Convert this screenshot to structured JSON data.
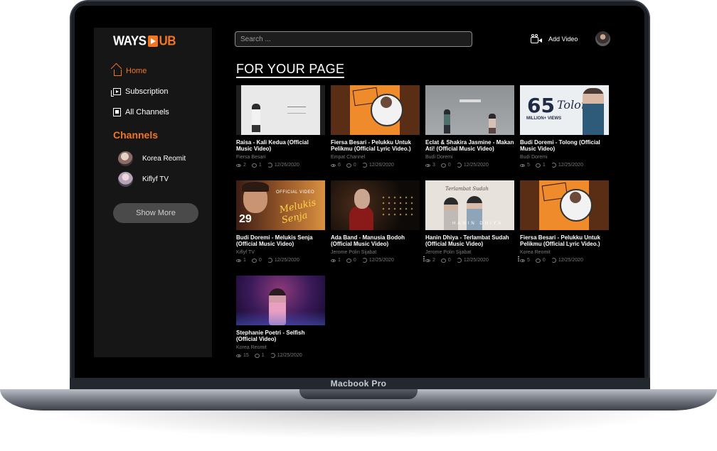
{
  "device": {
    "model": "Macbook Pro"
  },
  "brand": {
    "logo_part1": "WAYS",
    "logo_part2": "UB",
    "accent": "#f47521"
  },
  "sidebar": {
    "nav": [
      {
        "label": "Home",
        "icon": "home-icon",
        "active": true
      },
      {
        "label": "Subscription",
        "icon": "subscription-icon",
        "active": false
      },
      {
        "label": "All Channels",
        "icon": "channels-icon",
        "active": false
      }
    ],
    "channels_title": "Channels",
    "channels": [
      {
        "name": "Korea Reomit",
        "icon": "avatar"
      },
      {
        "name": "Kiflyf TV",
        "icon": "avatar"
      }
    ],
    "show_more_label": "Show More"
  },
  "header": {
    "search_placeholder": "Search ...",
    "add_video_label": "Add Video",
    "add_video_icon": "video-camera-icon"
  },
  "page_title": "FOR YOUR PAGE",
  "videos": [
    {
      "title": "Raisa - Kali Kedua (Official Music Video)",
      "channel": "Fiersa Besari",
      "views": "2",
      "comments": "1",
      "date": "12/26/2020",
      "thumb": "t-raisa",
      "kebab": false
    },
    {
      "title": "Fiersa Besari - Pelukku Untuk Pelikmu (Official Lyric Video.)",
      "channel": "Empat Channel",
      "views": "6",
      "comments": "0",
      "date": "12/26/2020",
      "thumb": "t-fiersa",
      "kebab": false
    },
    {
      "title": "Eclat & Shakira Jasmine - Makan Ati! (Official Music Video)",
      "channel": "Budi Doremi",
      "views": "3",
      "comments": "0",
      "date": "12/25/2020",
      "thumb": "t-eclat",
      "kebab": false
    },
    {
      "title": "Budi Doremi - Tolong (Official Music Video)",
      "channel": "Budi Doremi",
      "views": "5",
      "comments": "1",
      "date": "12/25/2020",
      "thumb": "t-budi",
      "kebab": false
    },
    {
      "title": "Budi Doremi - Melukis Senja (Official Music Video)",
      "channel": "Kiflyf TV",
      "views": "1",
      "comments": "0",
      "date": "12/25/2020",
      "thumb": "t-melukis",
      "kebab": false
    },
    {
      "title": "Ada Band - Manusia Bodoh (Official Music Video)",
      "channel": "Jerome Polin Sijabat",
      "views": "1",
      "comments": "0",
      "date": "12/25/2020",
      "thumb": "t-ada",
      "kebab": true
    },
    {
      "title": "Hanin Dhiya - Terlambat Sudah (Official Music Video)",
      "channel": "Jerome Polin Sijabat",
      "views": "2",
      "comments": "0",
      "date": "12/25/2020",
      "thumb": "t-hanin",
      "kebab": true
    },
    {
      "title": "Fiersa Besari - Pelukku Untuk Pelikmu (Official Lyric Video.)",
      "channel": "Korea Reomit",
      "views": "5",
      "comments": "0",
      "date": "12/25/2020",
      "thumb": "t-fiersa",
      "kebab": false
    },
    {
      "title": "Stephanie Poetri - Selfish (Official Video)",
      "channel": "Korea Reomit",
      "views": "15",
      "comments": "1",
      "date": "12/25/2020",
      "thumb": "t-stephanie",
      "kebab": false
    }
  ],
  "thumb_texts": {
    "raisa": "",
    "budi_num": "65",
    "budi_m": "MILLION+ VIEWS",
    "budi_tol": "Tolong",
    "melukis_n": "29",
    "melukis_script": "Melukis Senja",
    "melukis_ov": "OFFICIAL VIDEO",
    "hanin_txt": "Terlambat Sudah",
    "hanin_name": "HANIN DHIYA"
  }
}
